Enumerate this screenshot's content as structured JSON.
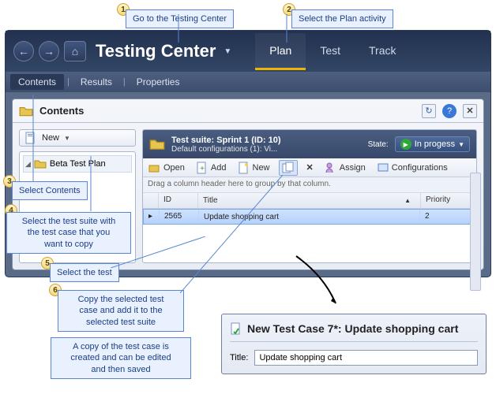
{
  "callouts": {
    "c1": "Go to the Testing Center",
    "c2": "Select the Plan activity",
    "c3": "Select Contents",
    "c4": "Select the test suite with\nthe test case that you\nwant to copy",
    "c5": "Select the test",
    "c6": "Copy the selected test\ncase and add it to the\nselected test suite",
    "c7": "A copy of the test case is\ncreated and can be edited\nand then saved"
  },
  "app": {
    "title": "Testing Center",
    "tabs": [
      "Plan",
      "Test",
      "Track"
    ],
    "activeTab": "Plan",
    "subtabs": [
      "Contents",
      "Results",
      "Properties"
    ],
    "activeSubtab": "Contents"
  },
  "panel": {
    "title": "Contents",
    "newLabel": "New",
    "treeItem": "Beta Test Plan"
  },
  "suite": {
    "title": "Test suite:  Sprint 1 (ID: 10)",
    "subtitle": "Default configurations (1): Vi...",
    "stateLabel": "State:",
    "stateValue": "In progess"
  },
  "toolbar": {
    "open": "Open",
    "add": "Add",
    "newtc": "New",
    "assign": "Assign",
    "config": "Configurations"
  },
  "grid": {
    "groupHint": "Drag a column header here to group by that column.",
    "cols": {
      "id": "ID",
      "title": "Title",
      "priority": "Priority"
    },
    "row": {
      "id": "2565",
      "title": "Update shopping cart",
      "priority": "2"
    }
  },
  "detail": {
    "heading": "New Test Case 7*: Update shopping cart",
    "titleLabel": "Title:",
    "titleValue": "Update shopping cart"
  },
  "nums": {
    "n1": "1",
    "n2": "2",
    "n3": "3",
    "n4": "4",
    "n5": "5",
    "n6": "6"
  }
}
